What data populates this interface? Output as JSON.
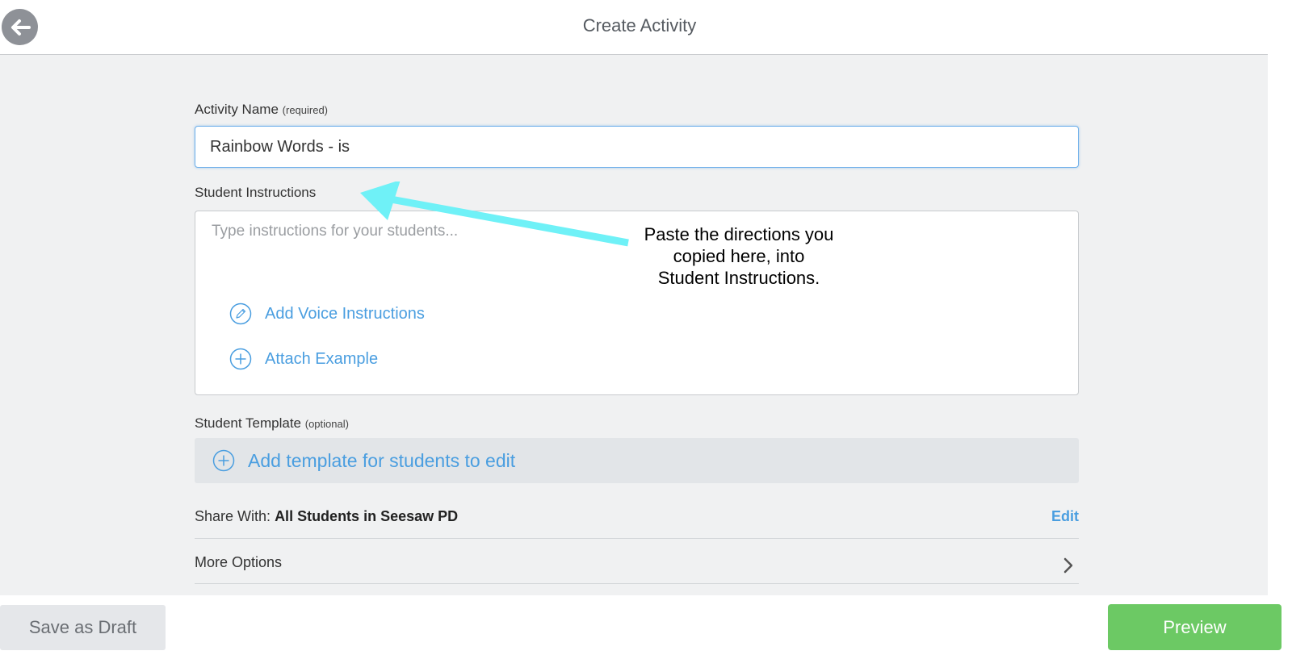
{
  "header": {
    "title": "Create Activity",
    "back_icon": "arrow-left-icon"
  },
  "activity_name": {
    "label": "Activity Name",
    "hint": "(required)",
    "value": "Rainbow Words - is"
  },
  "student_instructions": {
    "label": "Student Instructions",
    "placeholder": "Type instructions for your students...",
    "add_voice_label": "Add Voice Instructions",
    "add_voice_icon": "pencil-circle-icon",
    "attach_example_label": "Attach Example",
    "attach_example_icon": "plus-circle-icon"
  },
  "student_template": {
    "label": "Student Template",
    "hint": "(optional)",
    "add_label": "Add template for students to edit",
    "add_icon": "plus-circle-icon"
  },
  "share": {
    "label": "Share With:",
    "value": "All Students in Seesaw PD",
    "edit_label": "Edit"
  },
  "more_options": {
    "label": "More Options",
    "icon": "chevron-right-icon"
  },
  "annotation": {
    "lines": [
      "Paste the directions you",
      "copied here, into",
      "Student Instructions."
    ],
    "color": "#6ff1f7"
  },
  "footer": {
    "draft_label": "Save as Draft",
    "preview_label": "Preview"
  },
  "colors": {
    "accent_blue": "#4a9ee0",
    "preview_green": "#6cc964",
    "background": "#f0f1f2"
  }
}
